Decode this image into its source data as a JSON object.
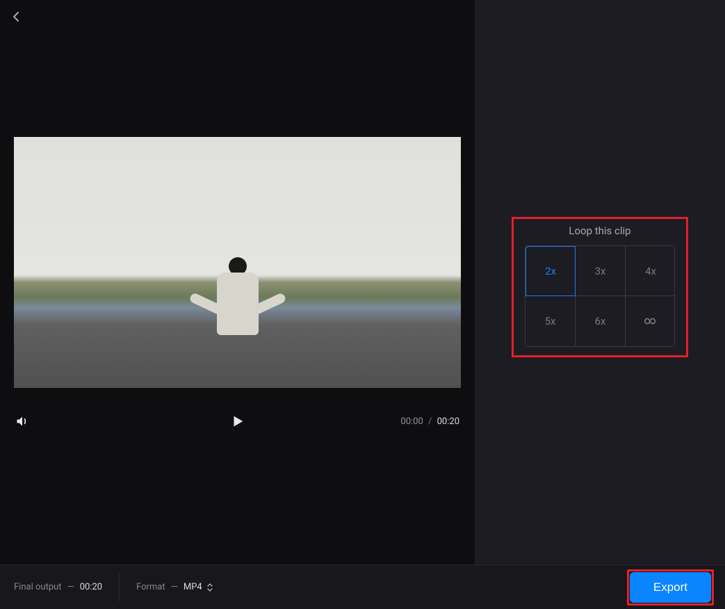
{
  "player": {
    "current_time": "00:00",
    "separator": "/",
    "total_time": "00:20"
  },
  "loop": {
    "title": "Loop this clip",
    "options": [
      "2x",
      "3x",
      "4x",
      "5x",
      "6x",
      "∞"
    ],
    "selected_index": 0
  },
  "bottom": {
    "final_output_label": "Final output",
    "dash": "—",
    "final_output_value": "00:20",
    "format_label": "Format",
    "format_value": "MP4",
    "export_label": "Export"
  }
}
